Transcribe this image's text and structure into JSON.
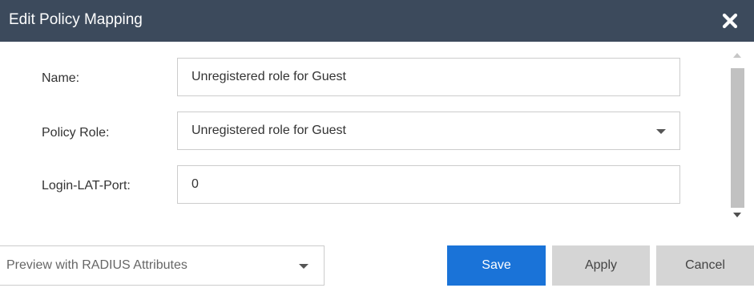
{
  "dialog": {
    "title": "Edit Policy Mapping",
    "close_icon": "close-icon"
  },
  "form": {
    "name": {
      "label": "Name:",
      "value": "Unregistered role for Guest"
    },
    "policy_role": {
      "label": "Policy Role:",
      "value": "Unregistered role for Guest"
    },
    "login_lat_port": {
      "label": "Login-LAT-Port:",
      "value": "0"
    }
  },
  "footer": {
    "preview_select": {
      "value": "Preview with RADIUS Attributes"
    },
    "save_label": "Save",
    "apply_label": "Apply",
    "cancel_label": "Cancel"
  },
  "colors": {
    "titlebar": "#3c4a5c",
    "primary": "#1a73d8",
    "secondary_button": "#d5d5d5"
  }
}
